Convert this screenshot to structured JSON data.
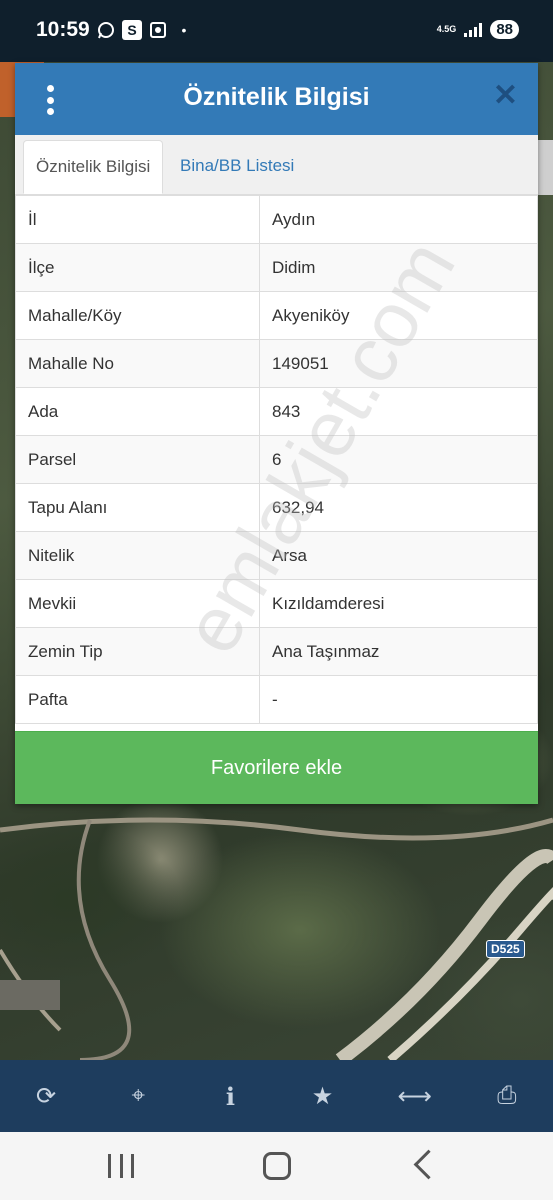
{
  "status_bar": {
    "time": "10:59",
    "icons": [
      "whatsapp-icon",
      "s-app-icon",
      "screenshot-icon",
      "dot-icon"
    ],
    "s_badge": "S",
    "network": "4.5G",
    "battery": "88"
  },
  "modal": {
    "title": "Öznitelik Bilgisi",
    "tabs": [
      {
        "label": "Öznitelik Bilgisi",
        "active": true
      },
      {
        "label": "Bina/BB Listesi",
        "active": false
      }
    ],
    "rows": [
      {
        "key": "İl",
        "value": "Aydın"
      },
      {
        "key": "İlçe",
        "value": "Didim"
      },
      {
        "key": "Mahalle/Köy",
        "value": "Akyeniköy"
      },
      {
        "key": "Mahalle No",
        "value": "149051"
      },
      {
        "key": "Ada",
        "value": "843"
      },
      {
        "key": "Parsel",
        "value": "6"
      },
      {
        "key": "Tapu Alanı",
        "value": "632,94"
      },
      {
        "key": "Nitelik",
        "value": "Arsa"
      },
      {
        "key": "Mevkii",
        "value": "Kızıldamderesi"
      },
      {
        "key": "Zemin Tip",
        "value": "Ana Taşınmaz"
      },
      {
        "key": "Pafta",
        "value": "-"
      }
    ],
    "favorite_button": "Favorilere ekle",
    "watermark": "emlakjet.com"
  },
  "map": {
    "road_label": "D525"
  },
  "toolbar": {
    "items": [
      "refresh-icon",
      "crosshair-icon",
      "info-icon",
      "star-icon",
      "measure-icon",
      "print-icon"
    ]
  },
  "colors": {
    "header": "#337ab7",
    "button": "#5cb85c",
    "toolbar": "#1e3d5e"
  }
}
